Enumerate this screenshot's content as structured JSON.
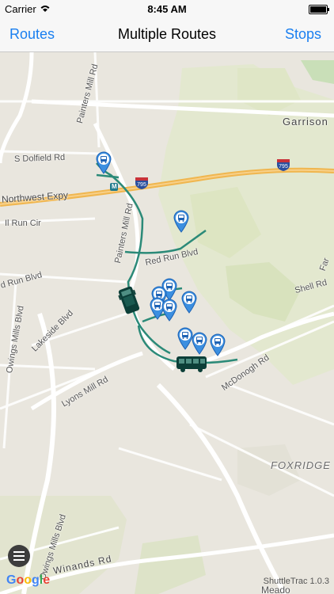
{
  "status": {
    "carrier": "Carrier",
    "time": "8:45 AM"
  },
  "nav": {
    "left": "Routes",
    "title": "Multiple Routes",
    "right": "Stops"
  },
  "map": {
    "labels": {
      "garrison": "Garrison",
      "dolfield": "S Dolfield Rd",
      "painters_mill_top": "Painters Mill Rd",
      "painters_mill_mid": "Painters Mill Rd",
      "northwest_expy": "Northwest Expy",
      "shield_795_left": "795",
      "shield_795_right": "795",
      "metro_m": "M",
      "red_run_cir": "Il Run Cir",
      "red_run_blvd_left": "d Run Blvd",
      "red_run_blvd": "Red Run Blvd",
      "shell_rd": "Shell Rd",
      "lakeside": "Lakeside Blvd",
      "owings_top": "Owings Mills Blvd",
      "lyons": "Lyons Mill Rd",
      "mcdonogh": "McDonogh Rd",
      "foxridge": "FOXRIDGE",
      "owings_bottom": "Owings Mills Blvd",
      "winands": "Winands Rd",
      "meadow": "Meado",
      "far": "Far"
    },
    "colors": {
      "route": "#2b8a78",
      "pin": "#3c8fe0",
      "bus": "#0c3f38"
    }
  },
  "footer": {
    "google": [
      "G",
      "o",
      "o",
      "g",
      "l",
      "e"
    ],
    "version": "ShuttleTrac 1.0.3"
  }
}
